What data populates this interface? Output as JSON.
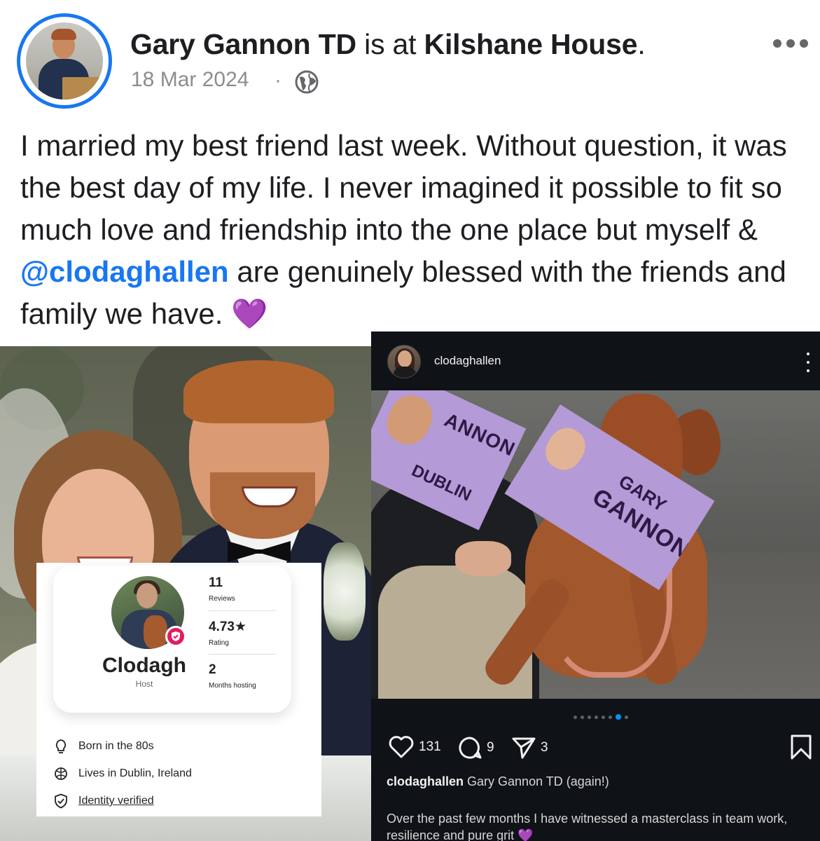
{
  "post": {
    "author": "Gary Gannon TD",
    "connector": " is at ",
    "location": "Kilshane House",
    "location_suffix": ".",
    "date": "18 Mar 2024",
    "date_separator": "·",
    "audience_icon": "globe-icon",
    "text_before_mention": "I married my best friend last week. Without question, it was the best day of my life. I never imagined it possible to fit so much love and friendship into the one place but myself & ",
    "mention": "@clodaghallen",
    "text_after_mention": " are genuinely blessed with the friends and family we have. ",
    "emoji": "💜"
  },
  "host_profile": {
    "name": "Clodagh",
    "role": "Host",
    "stats": [
      {
        "value": "11",
        "label": "Reviews"
      },
      {
        "value": "4.73★",
        "label": "Rating"
      },
      {
        "value": "2",
        "label": "Months hosting"
      }
    ],
    "facts": [
      {
        "icon": "lightbulb-icon",
        "text": "Born in the 80s"
      },
      {
        "icon": "globe-icon",
        "text": "Lives in Dublin, Ireland"
      },
      {
        "icon": "shield-check-icon",
        "text": "Identity verified"
      }
    ],
    "accent_color": "#e31c5f"
  },
  "instagram": {
    "username": "clodaghallen",
    "leaflet_text": {
      "name1": "ANNON",
      "area": "DUBLIN",
      "name_first": "GARY",
      "name_last": "GANNON"
    },
    "likes": "131",
    "comments": "9",
    "shares": "3",
    "carousel": {
      "count": 8,
      "active_index": 6
    },
    "caption_user": "clodaghallen",
    "caption_title": " Gary Gannon TD (again!)",
    "caption_body": "Over the past few months I have witnessed a masterclass in team work, resilience and pure grit 💜",
    "accent_color": "#0095f6"
  },
  "colors": {
    "facebook_blue": "#1877f2",
    "meta_gray": "#8a8d91",
    "instagram_bg": "#0f1216"
  }
}
